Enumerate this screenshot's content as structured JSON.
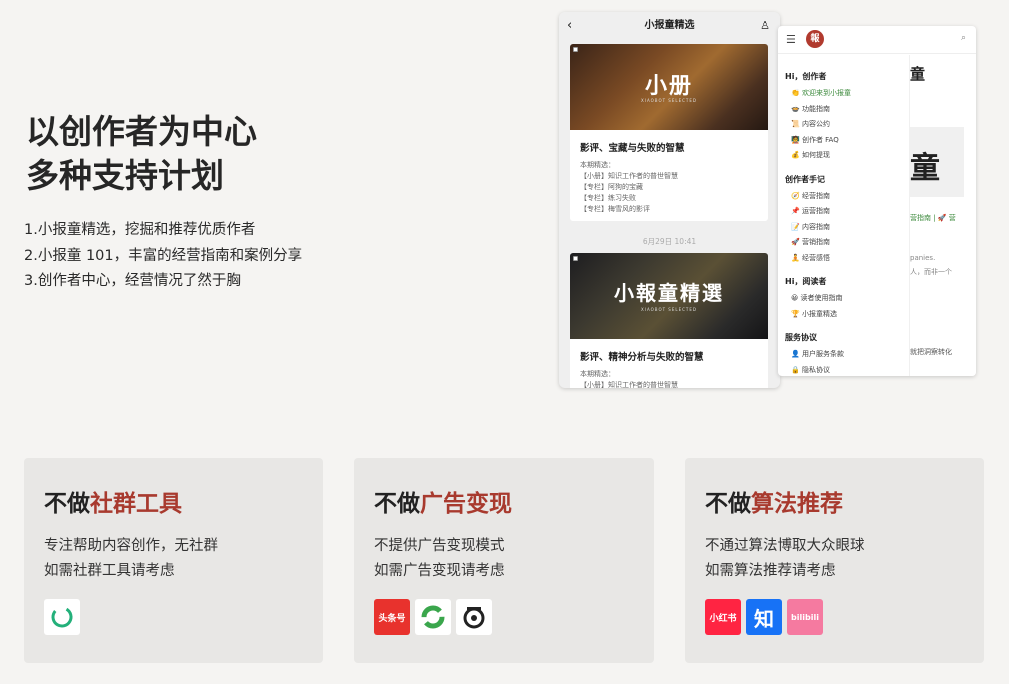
{
  "hero": {
    "title_line1": "以创作者为中心",
    "title_line2": "多种支持计划",
    "points": [
      "1.小报童精选，挖掘和推荐优质作者",
      "2.小报童 101，丰富的经营指南和案例分享",
      "3.创作者中心，经营情况了然于胸"
    ]
  },
  "phone": {
    "title": "小报童精选",
    "card1": {
      "cover_text": "小册",
      "cover_sub": "XIAOBOT SELECTED",
      "title": "影评、宝藏与失败的智慧",
      "lines": [
        "本期精选：",
        "【小册】知识工作者的普世智慧",
        "【专栏】阿狗的宝藏",
        "【专栏】练习失败",
        "【专栏】梅雪风的影评"
      ]
    },
    "time": "6月29日 10:41",
    "card2": {
      "cover_text": "小報童精選",
      "cover_sub": "XIAOBOT SELECTED",
      "title": "影评、精神分析与失败的智慧",
      "lines": [
        "本期精选：",
        "【小册】知识工作者的普世智慧"
      ]
    }
  },
  "web": {
    "logo": "報",
    "sections": [
      {
        "title": "Hi，创作者",
        "items": [
          "👏 欢迎来到小报童",
          "🍲 功能指南",
          "📜 内容公约",
          "🧑‍🏫 创作者 FAQ",
          "💰 如何提现"
        ]
      },
      {
        "title": "创作者手记",
        "items": [
          "🧭 经营指南",
          "📌 运营指南",
          "📝 内容指南",
          "🚀 营销指南",
          "🧘 经营感悟"
        ]
      },
      {
        "title": "Hi，阅读者",
        "items": [
          "😀 读者使用指南",
          "🏆 小报童精选"
        ]
      },
      {
        "title": "服务协议",
        "items": [
          "👤 用户服务条款",
          "🔒 隐私协议"
        ]
      }
    ],
    "right": {
      "heading": "童",
      "box_char": "童",
      "links": "营指南 | 🚀 营",
      "en": "panies.",
      "zh1": "人，而非一个",
      "zh2": "就把洞察转化"
    }
  },
  "cards": [
    {
      "prefix": "不做",
      "highlight": "社群工具",
      "desc1": "专注帮助内容创作，无社群",
      "desc2": "如需社群工具请考虑",
      "icons": [
        {
          "name": "circle-logo-icon",
          "bg": "#ffffff"
        }
      ]
    },
    {
      "prefix": "不做",
      "highlight": "广告变现",
      "desc1": "不提供广告变现模式",
      "desc2": "如需广告变现请考虑",
      "icons": [
        {
          "name": "toutiao-icon",
          "label": "头条号",
          "bg": "#e8322d"
        },
        {
          "name": "green-arrow-icon",
          "bg": "#ffffff"
        },
        {
          "name": "baijia-icon",
          "bg": "#ffffff"
        }
      ]
    },
    {
      "prefix": "不做",
      "highlight": "算法推荐",
      "desc1": "不通过算法博取大众眼球",
      "desc2": "如需算法推荐请考虑",
      "icons": [
        {
          "name": "xiaohongshu-icon",
          "label": "小红书",
          "bg": "#ff2442"
        },
        {
          "name": "zhihu-icon",
          "label": "知",
          "bg": "#1772f6"
        },
        {
          "name": "bilibili-icon",
          "label": "bilibili",
          "bg": "#f57aa0"
        }
      ]
    }
  ],
  "colors": {
    "accent": "#a83a2e",
    "card_bg": "#e8e7e5",
    "page_bg": "#f5f4f2"
  }
}
